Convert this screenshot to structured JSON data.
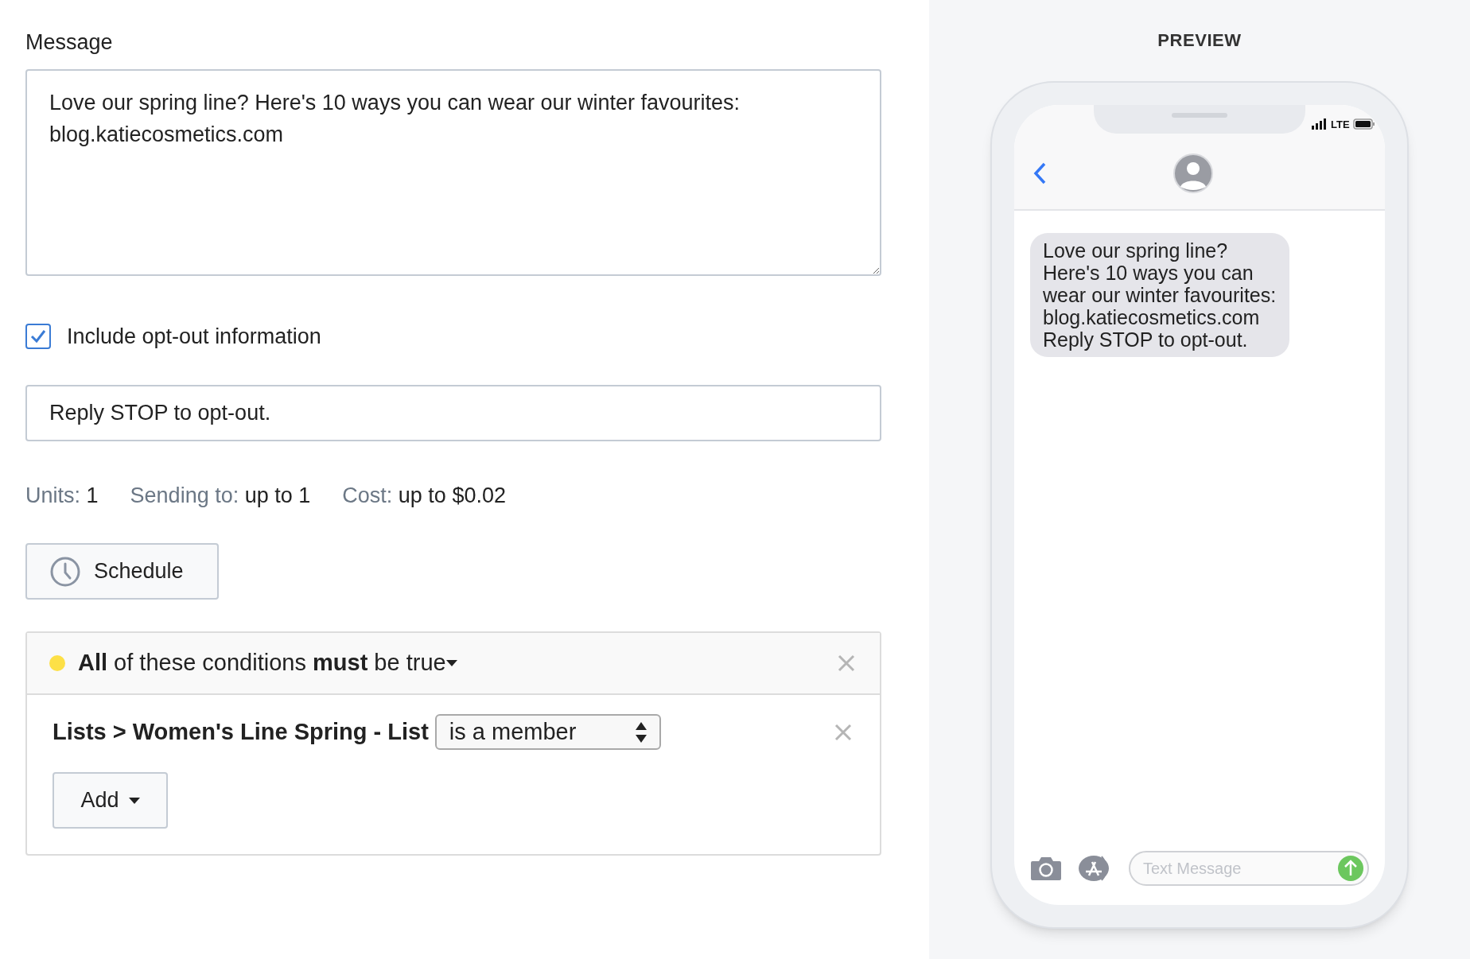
{
  "message": {
    "label": "Message",
    "value": "Love our spring line? Here's 10 ways you can wear our winter favourites:\nblog.katiecosmetics.com"
  },
  "opt_out": {
    "label": "Include opt-out information",
    "checked": true,
    "value": "Reply STOP to opt-out."
  },
  "stats": [
    {
      "label": "Units:",
      "value": "1"
    },
    {
      "label": "Sending to:",
      "value": "up to 1"
    },
    {
      "label": "Cost:",
      "value": "up to $0.02"
    }
  ],
  "schedule_button": "Schedule",
  "conditions": {
    "header": "**All** of these conditions **must** be true",
    "rows": [
      {
        "field": "Lists > Women's Line Spring - List",
        "operator": "is a member"
      }
    ],
    "add_button": "Add"
  },
  "preview": {
    "title": "PREVIEW",
    "network": "LTE",
    "bubble": "Love our spring line? Here's 10 ways you can wear our winter favourites:\nblog.katiecosmetics.com\nReply STOP to opt-out.",
    "input_placeholder": "Text Message"
  }
}
